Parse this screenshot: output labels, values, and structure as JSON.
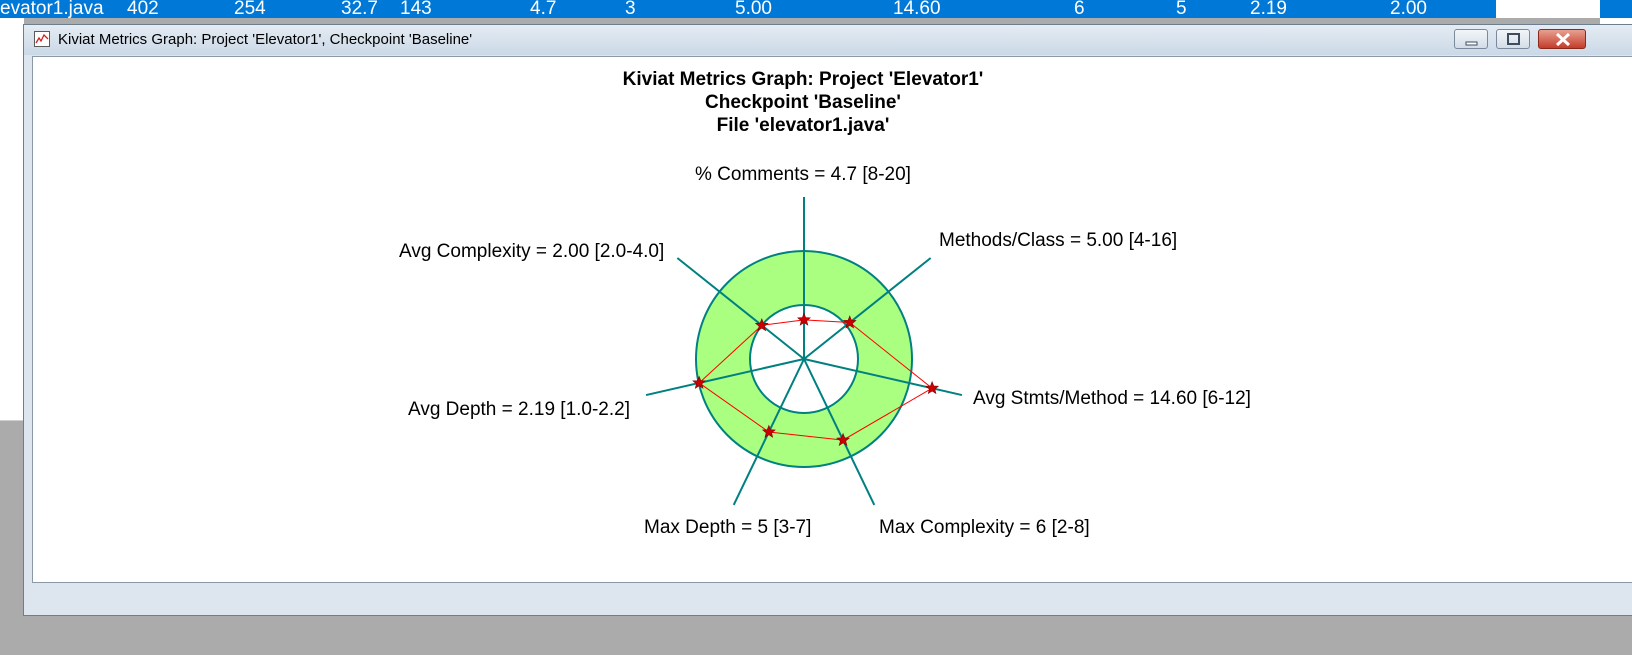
{
  "background_row": {
    "filename": "evator1.java",
    "values": [
      "402",
      "254",
      "32.7",
      "143",
      "4.7",
      "3",
      "5.00",
      "14.60",
      "6",
      "5",
      "2.19",
      "2.00"
    ]
  },
  "window": {
    "title": "Kiviat Metrics Graph: Project 'Elevator1', Checkpoint 'Baseline'",
    "icon": "line-graph-icon",
    "controls": [
      "minimize-icon",
      "maximize-icon",
      "close-icon"
    ]
  },
  "graph": {
    "title_lines": [
      "Kiviat Metrics Graph: Project 'Elevator1'",
      "Checkpoint 'Baseline'",
      "File 'elevator1.java'"
    ]
  },
  "chart_data": {
    "type": "radar",
    "axes": [
      {
        "label": "% Comments = 4.7 [8-20]",
        "value": 4.7,
        "range": [
          8,
          20
        ]
      },
      {
        "label": "Methods/Class = 5.00 [4-16]",
        "value": 5.0,
        "range": [
          4,
          16
        ]
      },
      {
        "label": "Avg Stmts/Method = 14.60 [6-12]",
        "value": 14.6,
        "range": [
          6,
          12
        ]
      },
      {
        "label": "Max Complexity = 6 [2-8]",
        "value": 6,
        "range": [
          2,
          8
        ]
      },
      {
        "label": "Max Depth = 5 [3-7]",
        "value": 5,
        "range": [
          3,
          7
        ]
      },
      {
        "label": "Avg Depth = 2.19 [1.0-2.2]",
        "value": 2.19,
        "range": [
          1.0,
          2.2
        ]
      },
      {
        "label": "Avg Complexity = 2.00 [2.0-4.0]",
        "value": 2.0,
        "range": [
          2.0,
          4.0
        ]
      }
    ],
    "colors": {
      "band": "#aaff80",
      "spokes": "#008080",
      "polygon": "#ff0000",
      "markers": "#cc0000"
    }
  }
}
